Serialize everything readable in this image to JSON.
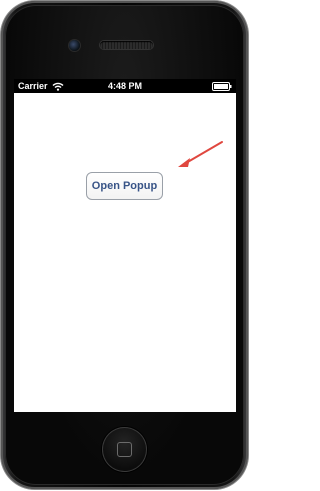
{
  "status_bar": {
    "carrier": "Carrier",
    "time": "4:48 PM",
    "icons": [
      "wifi-icon",
      "battery-icon"
    ]
  },
  "main": {
    "button_label": "Open Popup"
  },
  "colors": {
    "button_text": "#385487",
    "arrow": "#e0473f",
    "device_body": "#050505"
  }
}
